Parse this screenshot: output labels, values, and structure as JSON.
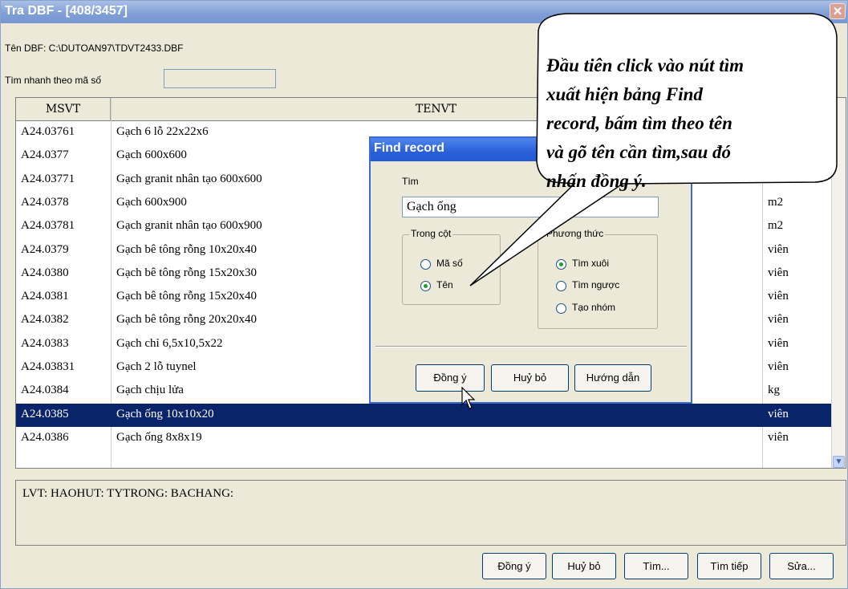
{
  "window": {
    "title": "Tra DBF - [408/3457]",
    "close_glyph": "✕"
  },
  "info": {
    "dbf_label": "Tên DBF:  C:\\DUTOAN97\\TDVT2433.DBF",
    "quick_search_label": "Tìm nhanh theo mã số",
    "quick_search_value": ""
  },
  "grid": {
    "columns": [
      "MSVT",
      "TENVT",
      ""
    ],
    "rows": [
      {
        "msvt": "A24.03761",
        "tenvt": "Gạch 6 lỗ 22x22x6",
        "dv": ""
      },
      {
        "msvt": "A24.0377",
        "tenvt": "Gạch 600x600",
        "dv": ""
      },
      {
        "msvt": "A24.03771",
        "tenvt": "Gạch granit nhân tạo 600x600",
        "dv": ""
      },
      {
        "msvt": "A24.0378",
        "tenvt": "Gạch 600x900",
        "dv": "m2"
      },
      {
        "msvt": "A24.03781",
        "tenvt": "Gạch granit nhân tạo 600x900",
        "dv": "m2"
      },
      {
        "msvt": "A24.0379",
        "tenvt": "Gạch bê tông rỗng 10x20x40",
        "dv": "viên"
      },
      {
        "msvt": "A24.0380",
        "tenvt": "Gạch bê tông rỗng 15x20x30",
        "dv": "viên"
      },
      {
        "msvt": "A24.0381",
        "tenvt": "Gạch bê tông rỗng 15x20x40",
        "dv": "viên"
      },
      {
        "msvt": "A24.0382",
        "tenvt": "Gạch bê tông rỗng 20x20x40",
        "dv": "viên"
      },
      {
        "msvt": "A24.0383",
        "tenvt": "Gạch chỉ 6,5x10,5x22",
        "dv": "viên"
      },
      {
        "msvt": "A24.03831",
        "tenvt": "Gạch 2 lỗ tuynel",
        "dv": "viên"
      },
      {
        "msvt": "A24.0384",
        "tenvt": "Gạch chịu lửa",
        "dv": "kg"
      },
      {
        "msvt": "A24.0385",
        "tenvt": "Gạch ống 10x10x20",
        "dv": "viên"
      },
      {
        "msvt": "A24.0386",
        "tenvt": "Gạch ống 8x8x19",
        "dv": "viên"
      }
    ],
    "selected_index": 12
  },
  "status": {
    "text": "LVT:  HAOHUT:  TYTRONG:  BACHANG:"
  },
  "buttons": {
    "ok": "Đồng ý",
    "cancel": "Huỷ bỏ",
    "find": "Tìm...",
    "find_next": "Tìm tiếp",
    "edit": "Sửa..."
  },
  "find_dialog": {
    "title": "Find record",
    "find_label": "Tìm",
    "find_value": "Gạch ống",
    "column_group": "Trong cột",
    "col_code": "Mã số",
    "col_name": "Tên",
    "method_group": "Phương thức",
    "method_forward": "Tìm xuôi",
    "method_backward": "Tìm ngược",
    "method_group_make": "Tạo nhóm",
    "ok": "Đồng ý",
    "cancel": "Huỷ bỏ",
    "help": "Hướng dẫn"
  },
  "callout": {
    "lines": [
      "Đầu tiên click vào nút tìm",
      "xuất hiện bảng Find",
      "record, bấm tìm theo tên",
      "và gõ tên cần tìm,sau đó",
      "nhấn đồng ý."
    ]
  }
}
